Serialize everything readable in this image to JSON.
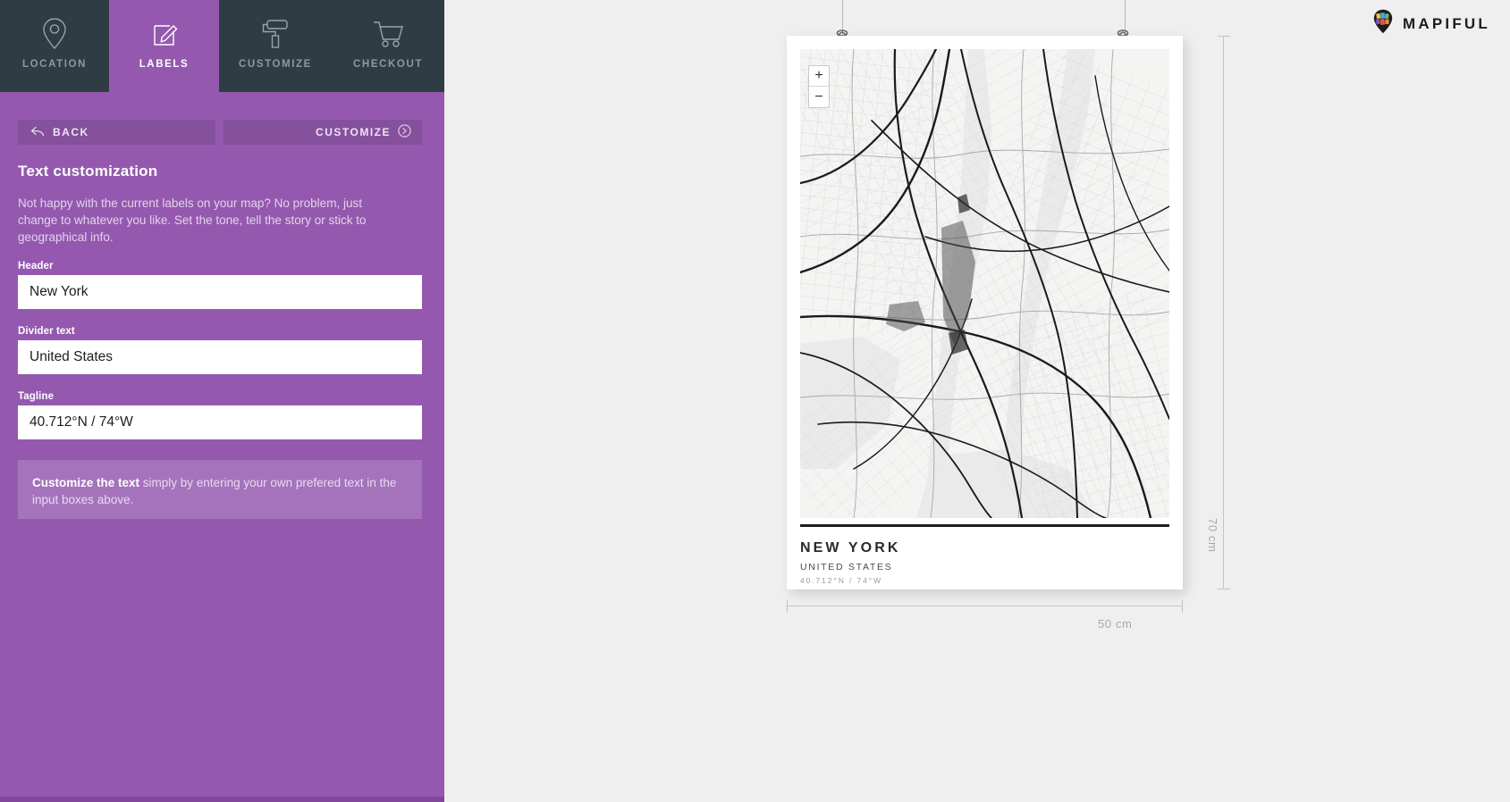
{
  "brand": {
    "name": "MAPIFUL",
    "logo_icon": "map-pin-logo-icon"
  },
  "nav": {
    "tabs": [
      {
        "id": "location",
        "label": "LOCATION",
        "icon": "map-pin-icon",
        "active": false
      },
      {
        "id": "labels",
        "label": "LABELS",
        "icon": "pencil-square-icon",
        "active": true
      },
      {
        "id": "customize",
        "label": "CUSTOMIZE",
        "icon": "paint-roller-icon",
        "active": false
      },
      {
        "id": "checkout",
        "label": "CHECKOUT",
        "icon": "shopping-cart-icon",
        "active": false
      }
    ]
  },
  "actions": {
    "back_label": "BACK",
    "back_icon": "back-arrow-icon",
    "customize_label": "CUSTOMIZE",
    "customize_icon": "chevron-right-circle-icon"
  },
  "panel": {
    "title": "Text customization",
    "description": "Not happy with the current labels on your map? No problem, just change to whatever you like. Set the tone, tell the story or stick to geographical info.",
    "fields": [
      {
        "id": "header",
        "label": "Header",
        "value": "New York"
      },
      {
        "id": "divider",
        "label": "Divider text",
        "value": "United States"
      },
      {
        "id": "tagline",
        "label": "Tagline",
        "value": "40.712°N / 74°W"
      }
    ],
    "hint": {
      "bold": "Customize the text",
      "rest": " simply by entering your own prefered text in the input boxes above."
    }
  },
  "poster": {
    "title": "NEW YORK",
    "subtitle": "UNITED STATES",
    "coords": "40.712°N / 74°W",
    "map_zoom_in": "+",
    "map_zoom_out": "−"
  },
  "dimensions": {
    "height_label": "70 cm",
    "width_label": "50 cm"
  },
  "colors": {
    "sidebar_purple": "#9459ae",
    "button_purple": "#85509c",
    "nav_dark": "#2f3c44",
    "canvas_gray": "#efefef"
  }
}
